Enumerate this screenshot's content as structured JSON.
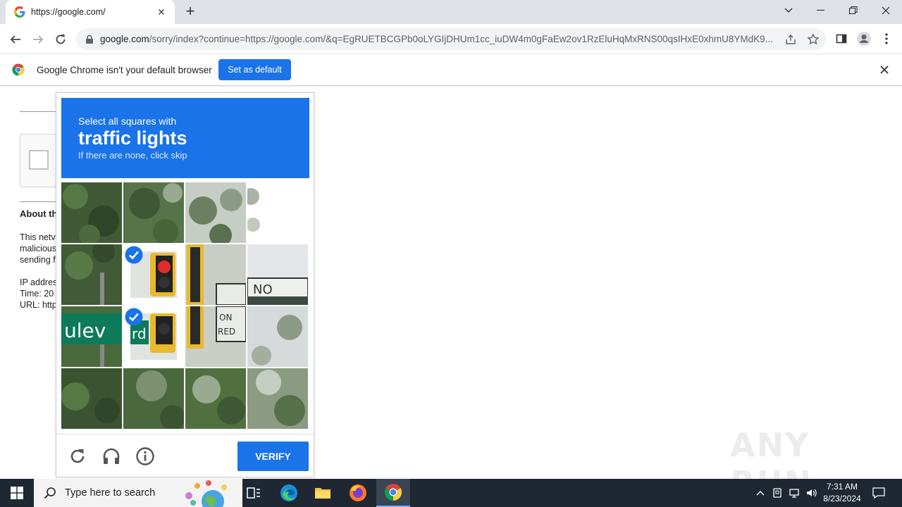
{
  "browser": {
    "tab_title": "https://google.com/",
    "url_host": "google.com",
    "url_path": "/sorry/index?continue=https://google.com/&q=EgRUETBCGPb0oLYGIjDHUm1cc_iuDW4m0gFaEw2ov1RzEluHqMxRNS00qsIHxE0xhmU8YMdK9..."
  },
  "infobar": {
    "message": "Google Chrome isn't your default browser",
    "button_label": "Set as default"
  },
  "sorry_page": {
    "about_heading": "About th",
    "lines": [
      "This netv",
      "malicious",
      "sending f"
    ],
    "ip_line": "IP addres",
    "time_line": "Time: 20",
    "url_line": "URL: http"
  },
  "captcha": {
    "instruction": "Select all squares with",
    "target": "traffic lights",
    "hint": "If there are none, click skip",
    "verify_label": "VERIFY",
    "selected_tiles": [
      5,
      9
    ],
    "colors": {
      "accent": "#1a73e8"
    }
  },
  "watermark": "ANY RUN",
  "taskbar": {
    "search_placeholder": "Type here to search",
    "time": "7:31 AM",
    "date": "8/23/2024"
  }
}
